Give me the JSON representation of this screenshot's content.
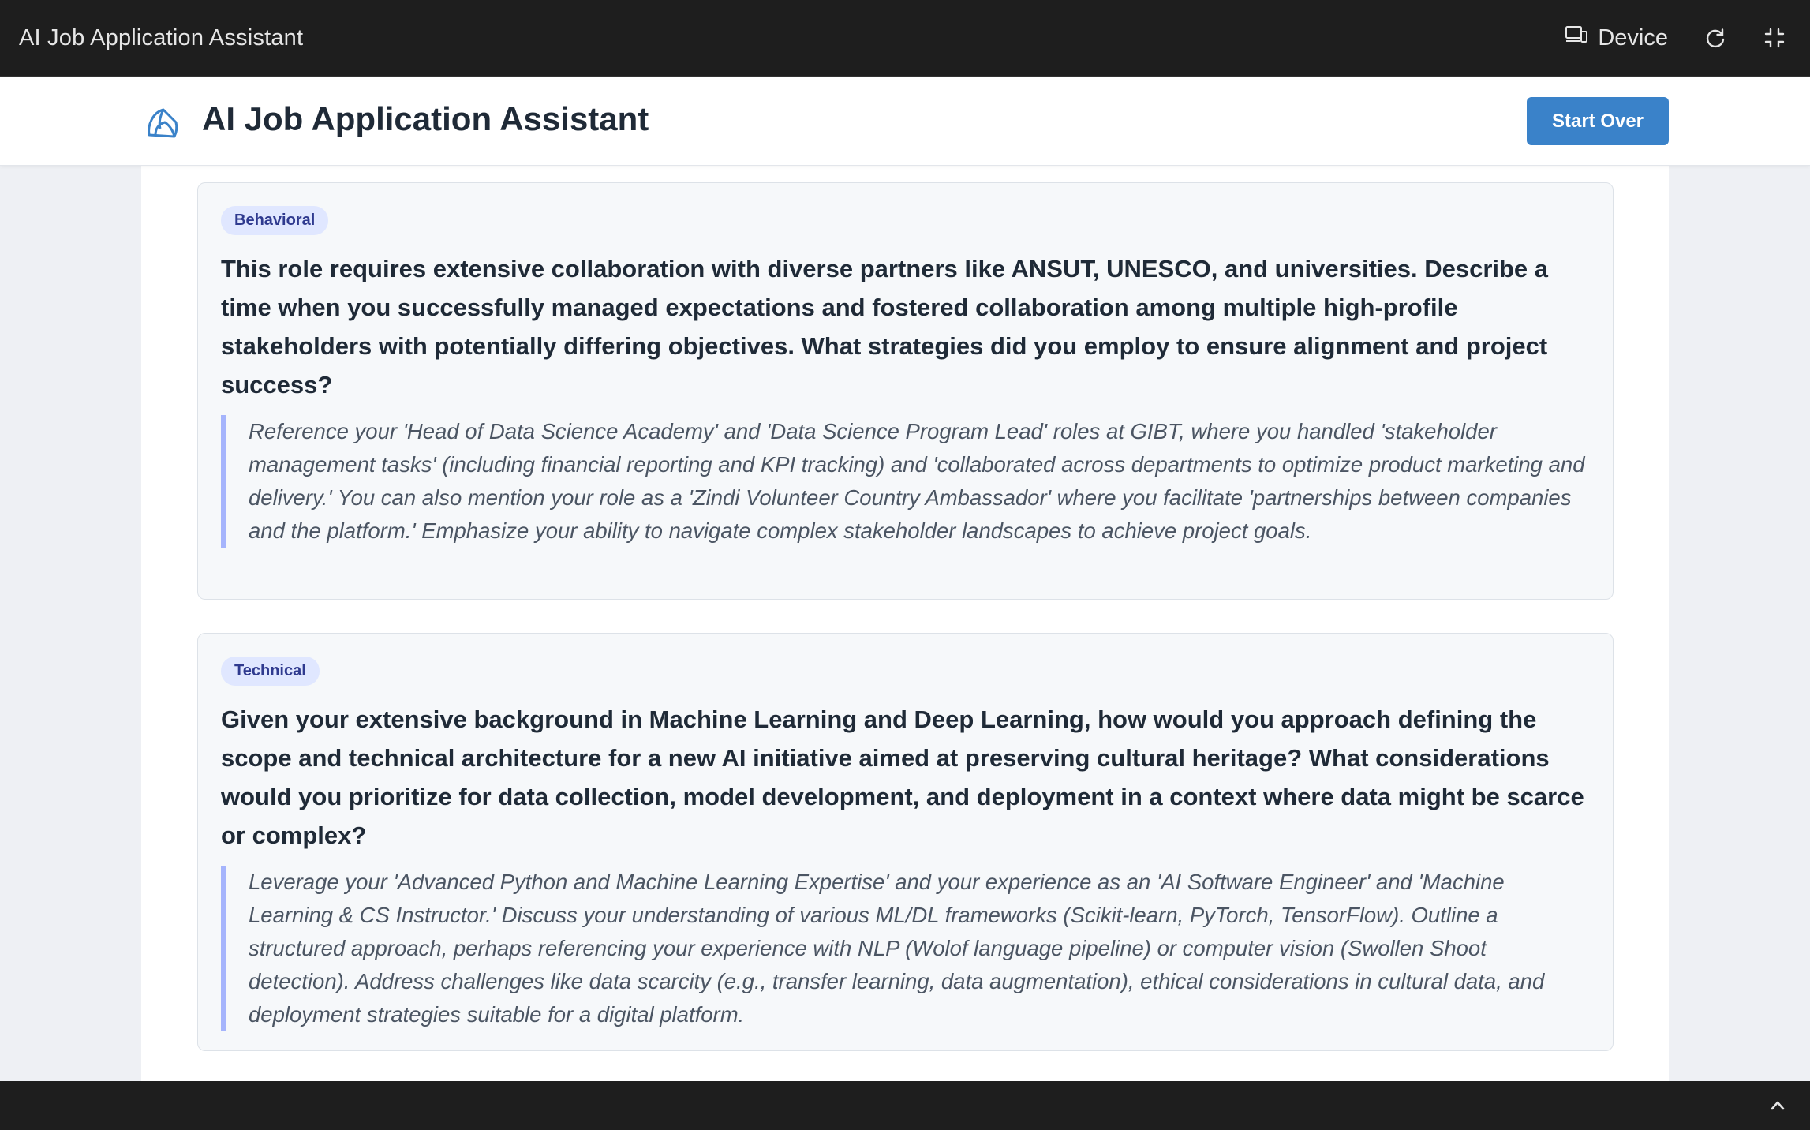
{
  "window": {
    "title": "AI Job Application Assistant",
    "device_label": "Device"
  },
  "header": {
    "title": "AI Job Application Assistant",
    "start_over_label": "Start Over"
  },
  "questions": [
    {
      "category": "Behavioral",
      "question": "This role requires extensive collaboration with diverse partners like ANSUT, UNESCO, and universities. Describe a time when you successfully managed expectations and fostered collaboration among multiple high-profile stakeholders with potentially differing objectives. What strategies did you employ to ensure alignment and project success?",
      "hint": "Reference your 'Head of Data Science Academy' and 'Data Science Program Lead' roles at GIBT, where you handled 'stakeholder management tasks' (including financial reporting and KPI tracking) and 'collaborated across departments to optimize product marketing and delivery.' You can also mention your role as a 'Zindi Volunteer Country Ambassador' where you facilitate 'partnerships between companies and the platform.' Emphasize your ability to navigate complex stakeholder landscapes to achieve project goals."
    },
    {
      "category": "Technical",
      "question": "Given your extensive background in Machine Learning and Deep Learning, how would you approach defining the scope and technical architecture for a new AI initiative aimed at preserving cultural heritage? What considerations would you prioritize for data collection, model development, and deployment in a context where data might be scarce or complex?",
      "hint": "Leverage your 'Advanced Python and Machine Learning Expertise' and your experience as an 'AI Software Engineer' and 'Machine Learning & CS Instructor.' Discuss your understanding of various ML/DL frameworks (Scikit-learn, PyTorch, TensorFlow). Outline a structured approach, perhaps referencing your experience with NLP (Wolof language pipeline) or computer vision (Swollen Shoot detection). Address challenges like data scarcity (e.g., transfer learning, data augmentation), ethical considerations in cultural data, and deployment strategies suitable for a digital platform."
    }
  ],
  "colors": {
    "accent": "#3a82c9",
    "badge_bg": "#e0e7ff",
    "hint_border": "#a5b4fc",
    "dark_bar": "#1e1e1e"
  },
  "icons": {
    "device": "device-icon",
    "reload": "reload-icon",
    "exit_fullscreen": "exit-fullscreen-icon",
    "logo": "app-logo-icon",
    "scroll_top": "chevron-up-icon"
  }
}
